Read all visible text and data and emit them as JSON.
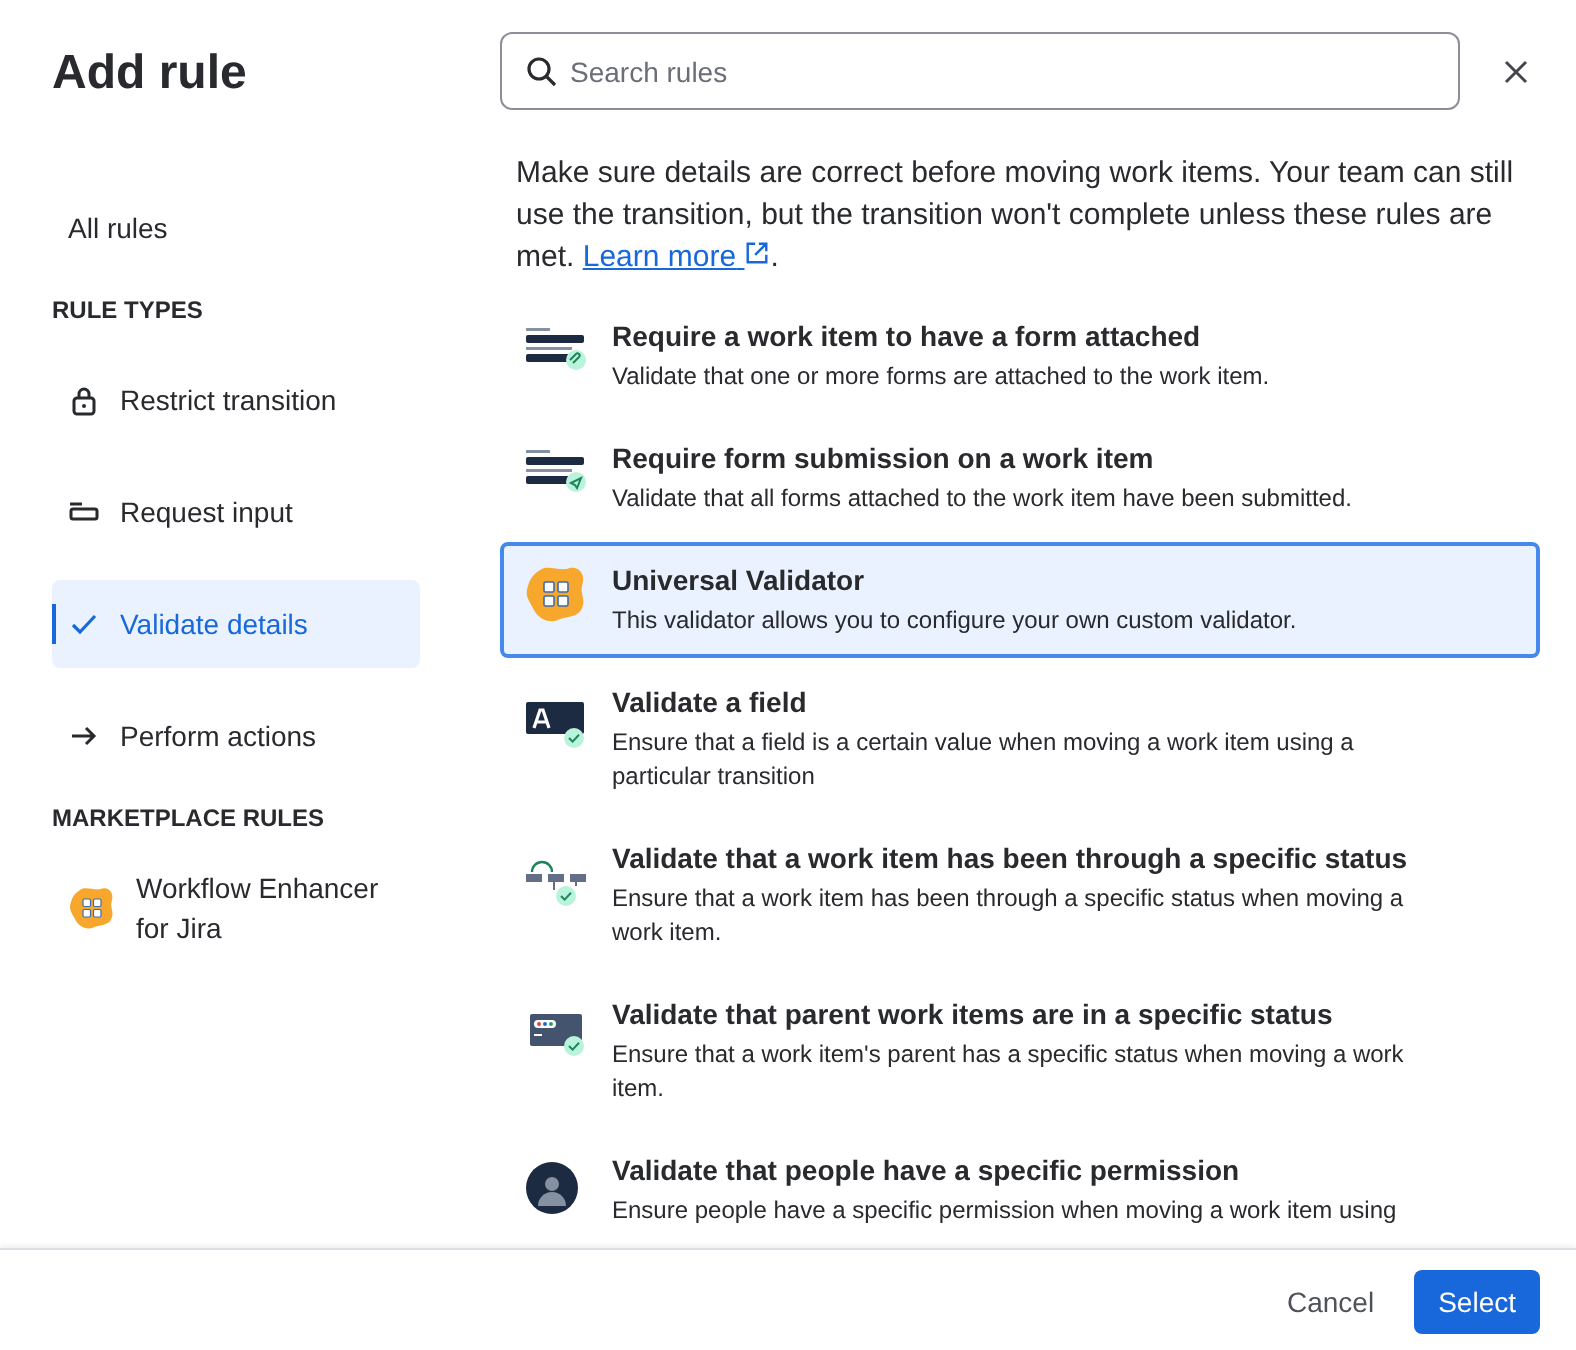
{
  "title": "Add rule",
  "sidebar": {
    "top_item": {
      "label": "All rules",
      "selected": false
    },
    "sections": [
      {
        "heading": "RULE TYPES",
        "items": [
          {
            "label": "Restrict transition",
            "kind": "lock",
            "selected": false
          },
          {
            "label": "Request input",
            "kind": "input",
            "selected": false
          },
          {
            "label": "Validate details",
            "kind": "check",
            "selected": true
          },
          {
            "label": "Perform actions",
            "kind": "arrow",
            "selected": false
          }
        ]
      },
      {
        "heading": "MARKETPLACE RULES",
        "items": [
          {
            "label": "Workflow Enhancer for Jira",
            "kind": "app",
            "selected": false
          }
        ]
      }
    ]
  },
  "search": {
    "placeholder": "Search rules"
  },
  "description": {
    "text": "Make sure details are correct before moving work items. Your team can still use the transition, but the transition won't complete unless these rules are met.",
    "link": "Learn more",
    "after_link": "."
  },
  "rules": [
    {
      "kind": "form-attached",
      "title": "Require a work item to have a form attached",
      "description": "Validate that one or more forms are attached to the work item.",
      "selected": false
    },
    {
      "kind": "form-submission",
      "title": "Require form submission on a work item",
      "description": "Validate that all forms attached to the work item have been submitted.",
      "selected": false
    },
    {
      "kind": "app",
      "title": "Universal Validator",
      "description": "This validator allows you to configure your own custom validator.",
      "selected": true
    },
    {
      "kind": "field",
      "title": "Validate a field",
      "description": "Ensure that a field is a certain value when moving a work item using a particular transition",
      "selected": false
    },
    {
      "kind": "status-path",
      "title": "Validate that a work item has been through a specific status",
      "description": "Ensure that a work item has been through a specific status when moving a work item.",
      "selected": false
    },
    {
      "kind": "parent-status",
      "title": "Validate that parent work items are in a specific status",
      "description": "Ensure that a work item's parent has a specific status when moving a work item.",
      "selected": false
    },
    {
      "kind": "person",
      "title": "Validate that people have a specific permission",
      "description": "Ensure people have a specific permission when moving a work item using",
      "selected": false
    }
  ],
  "footer": {
    "cancel": "Cancel",
    "confirm": "Select"
  }
}
